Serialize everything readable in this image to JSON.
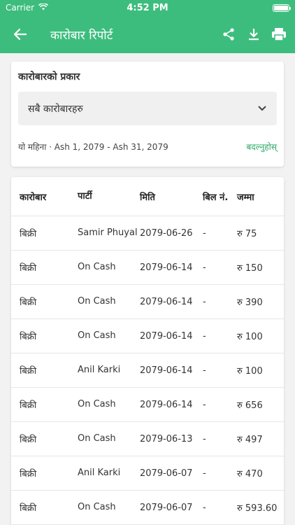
{
  "status_bar": {
    "carrier": "Carrier",
    "time": "4:52 PM",
    "battery_level": 1.0
  },
  "app_bar": {
    "title": "कारोबार रिपोर्ट"
  },
  "filter": {
    "label": "कारोबारको प्रकार",
    "selected": "सबै कारोबारहरु",
    "period": "यो महिना · Ash 1, 2079 - Ash 31, 2079",
    "change_link": "बदल्नुहोस्"
  },
  "table": {
    "headers": [
      "कारोबार",
      "पार्टी",
      "मिति",
      "बिल नं.",
      "जम्मा"
    ],
    "rows": [
      [
        "बिक्री",
        "Samir Phuyal",
        "2079-06-26",
        "-",
        "रु 75"
      ],
      [
        "बिक्री",
        "On Cash",
        "2079-06-14",
        "-",
        "रु 150"
      ],
      [
        "बिक्री",
        "On Cash",
        "2079-06-14",
        "-",
        "रु 390"
      ],
      [
        "बिक्री",
        "On Cash",
        "2079-06-14",
        "-",
        "रु 100"
      ],
      [
        "बिक्री",
        "Anil Karki",
        "2079-06-14",
        "-",
        "रु 100"
      ],
      [
        "बिक्री",
        "On Cash",
        "2079-06-14",
        "-",
        "रु 656"
      ],
      [
        "बिक्री",
        "On Cash",
        "2079-06-13",
        "-",
        "रु 497"
      ],
      [
        "बिक्री",
        "Anil Karki",
        "2079-06-07",
        "-",
        "रु 470"
      ],
      [
        "बिक्री",
        "On Cash",
        "2079-06-07",
        "-",
        "रु 593.60"
      ]
    ]
  },
  "colors": {
    "accent": "#3dbd7d",
    "link": "#2aa866"
  }
}
